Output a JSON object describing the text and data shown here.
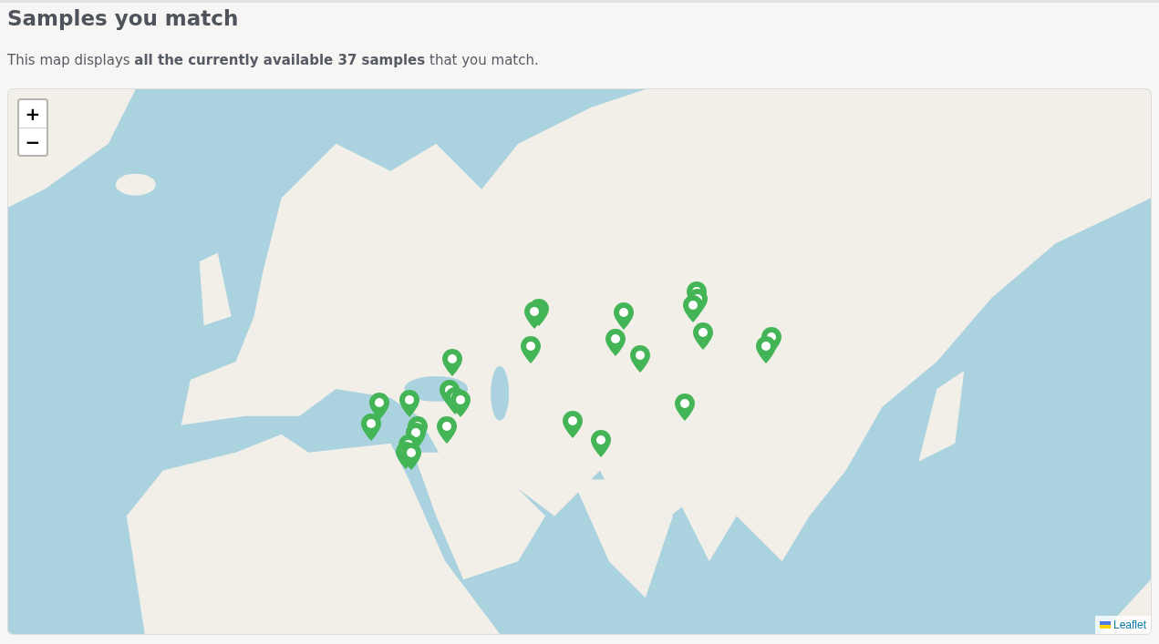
{
  "heading": "Samples you match",
  "intro": "This map displays **all the currently available 37 samples** that you match.",
  "map": {
    "zoom_in": "+",
    "zoom_out": "−",
    "attribution": "Leaflet"
  }
}
